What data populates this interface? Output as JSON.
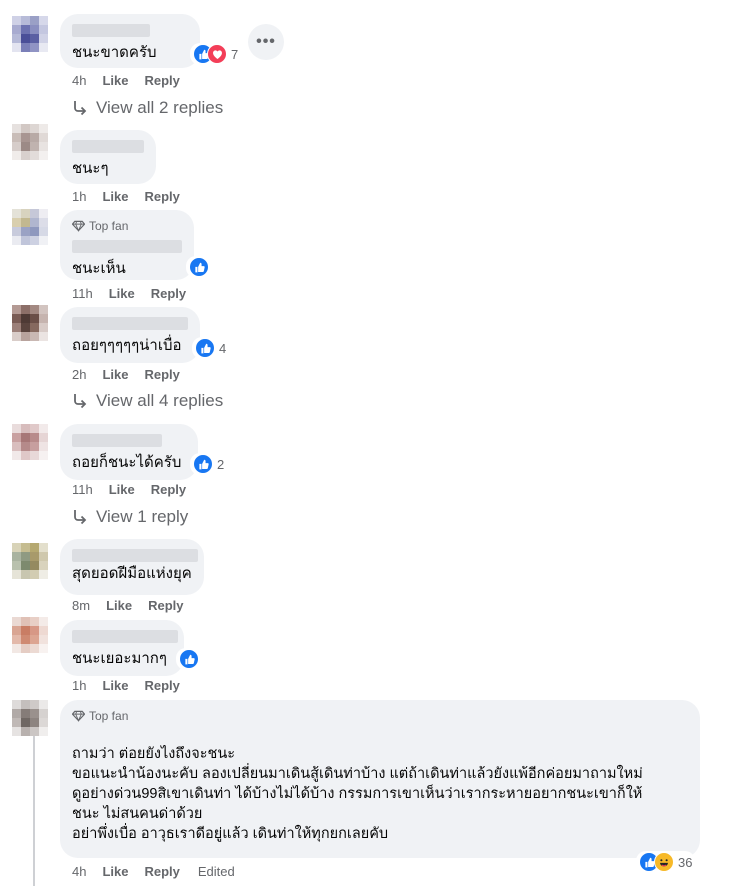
{
  "comments": [
    {
      "text": "ชนะขาดครับ",
      "time": "4h",
      "like": "Like",
      "reply": "Reply",
      "reactions": [
        "like-icon",
        "love-icon"
      ],
      "count": "7",
      "replies": "View all 2 replies"
    },
    {
      "text": "ชนะๆ",
      "time": "1h",
      "like": "Like",
      "reply": "Reply"
    },
    {
      "badge": "Top fan",
      "text": "ชนะเห็น",
      "time": "11h",
      "like": "Like",
      "reply": "Reply",
      "reactions": [
        "like-icon"
      ]
    },
    {
      "text": "ถอยๆๆๆๆๆน่าเบื่อ",
      "time": "2h",
      "like": "Like",
      "reply": "Reply",
      "reactions": [
        "like-icon"
      ],
      "count": "4",
      "replies": "View all 4 replies"
    },
    {
      "text": "ถอยก็ชนะได้ครับ",
      "time": "11h",
      "like": "Like",
      "reply": "Reply",
      "reactions": [
        "like-icon"
      ],
      "count": "2",
      "replies": "View 1 reply"
    },
    {
      "text": "สุดยอดฝีมือแห่งยุค",
      "time": "8m",
      "like": "Like",
      "reply": "Reply"
    },
    {
      "text": "ชนะเยอะมากๆ",
      "time": "1h",
      "like": "Like",
      "reply": "Reply",
      "reactions": [
        "like-icon"
      ]
    },
    {
      "badge": "Top fan",
      "text": "ถามว่า ต่อยยังไงถึงจะชนะ\nขอแนะนำน้องนะคับ ลองเปลี่ยนมาเดินสู้เดินท่าบ้าง แต่ถ้าเดินท่าแล้วยังแพ้อีกค่อยมาถามใหม่\nดูอย่างด่วน99สิเขาเดินท่า ได้บ้างไม่ได้บ้าง กรรมการเขาเห็นว่าเรากระหายอยากชนะเขาก็ให้\nชนะ ไม่สนคนด่าด้วย\nอย่าพึ่งเบื่อ อาวุธเราดีอยู่แล้ว เดินท่าให้ทุกยกเลยคับ",
      "time": "4h",
      "like": "Like",
      "reply": "Reply",
      "edited": "Edited",
      "reactions": [
        "like-icon",
        "haha-icon"
      ],
      "count": "36"
    }
  ],
  "more_icon": "more-options-icon",
  "colors": {
    "like": "#1877f2",
    "love": "#f33e58",
    "haha": "#f7b928",
    "bubble": "#f0f2f5",
    "meta": "#65676b"
  }
}
